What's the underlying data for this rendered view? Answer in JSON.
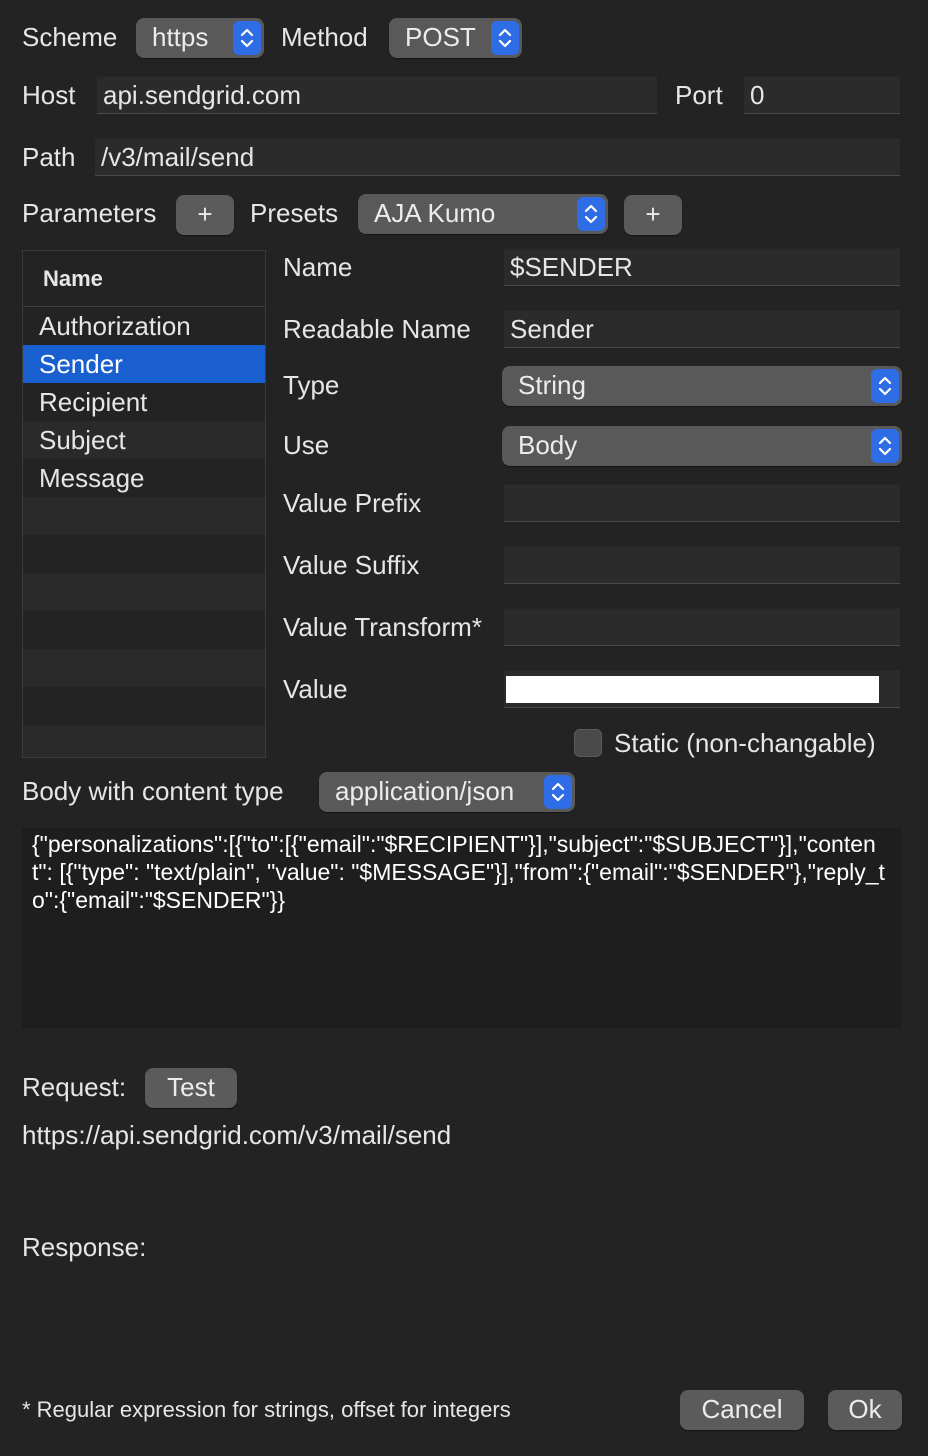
{
  "scheme": {
    "label": "Scheme",
    "value": "https"
  },
  "method": {
    "label": "Method",
    "value": "POST"
  },
  "host": {
    "label": "Host",
    "value": "api.sendgrid.com"
  },
  "port": {
    "label": "Port",
    "value": "0"
  },
  "path": {
    "label": "Path",
    "value": "/v3/mail/send"
  },
  "parameters": {
    "label": "Parameters",
    "add_label": "+"
  },
  "presets": {
    "label": "Presets",
    "value": "AJA Kumo",
    "add_label": "+"
  },
  "param_table": {
    "header": "Name",
    "rows": [
      "Authorization",
      "Sender",
      "Recipient",
      "Subject",
      "Message"
    ],
    "selected": "Sender"
  },
  "detail": {
    "name_label": "Name",
    "name_value": "$SENDER",
    "readable_label": "Readable Name",
    "readable_value": "Sender",
    "type_label": "Type",
    "type_value": "String",
    "use_label": "Use",
    "use_value": "Body",
    "prefix_label": "Value Prefix",
    "prefix_value": "",
    "suffix_label": "Value Suffix",
    "suffix_value": "",
    "transform_label": "Value Transform*",
    "transform_value": "",
    "value_label": "Value",
    "value_value": "",
    "static_label": "Static (non-changable)"
  },
  "body": {
    "label": "Body with content type",
    "content_type": "application/json",
    "text": "{\"personalizations\":[{\"to\":[{\"email\":\"$RECIPIENT\"}],\"subject\":\"$SUBJECT\"}],\"content\": [{\"type\": \"text/plain\", \"value\": \"$MESSAGE\"}],\"from\":{\"email\":\"$SENDER\"},\"reply_to\":{\"email\":\"$SENDER\"}}"
  },
  "request": {
    "label": "Request:",
    "test_label": "Test",
    "url": "https://api.sendgrid.com/v3/mail/send"
  },
  "response": {
    "label": "Response:"
  },
  "footer": {
    "note": "* Regular expression for strings, offset for integers",
    "cancel_label": "Cancel",
    "ok_label": "Ok"
  },
  "colors": {
    "background": "#232323",
    "accent": "#2f6de6",
    "selection": "#1a5fd0"
  }
}
